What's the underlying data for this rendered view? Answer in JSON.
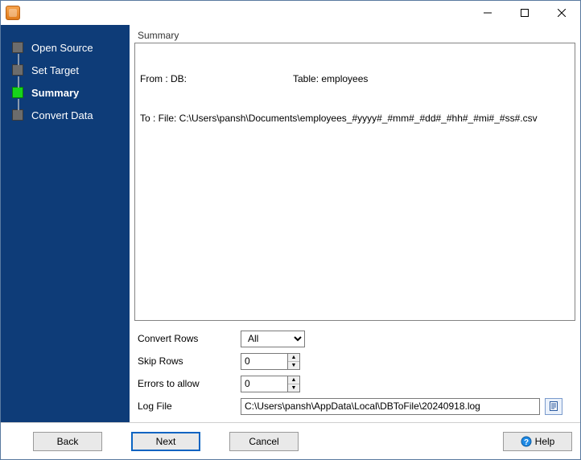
{
  "title": "",
  "sidebar": {
    "items": [
      {
        "label": "Open Source",
        "state": "done"
      },
      {
        "label": "Set Target",
        "state": "done"
      },
      {
        "label": "Summary",
        "state": "current"
      },
      {
        "label": "Convert Data",
        "state": "pending"
      }
    ]
  },
  "summary": {
    "heading": "Summary",
    "from_prefix": "From : DB:",
    "table_label": "Table: employees",
    "to_line": "To : File: C:\\Users\\pansh\\Documents\\employees_#yyyy#_#mm#_#dd#_#hh#_#mi#_#ss#.csv"
  },
  "form": {
    "convert_rows": {
      "label": "Convert Rows",
      "value": "All"
    },
    "skip_rows": {
      "label": "Skip Rows",
      "value": "0"
    },
    "errors_allow": {
      "label": "Errors to allow",
      "value": "0"
    },
    "log_file": {
      "label": "Log File",
      "value": "C:\\Users\\pansh\\AppData\\Local\\DBToFile\\20240918.log"
    }
  },
  "footer": {
    "back": "Back",
    "next": "Next",
    "cancel": "Cancel",
    "help": "Help"
  }
}
